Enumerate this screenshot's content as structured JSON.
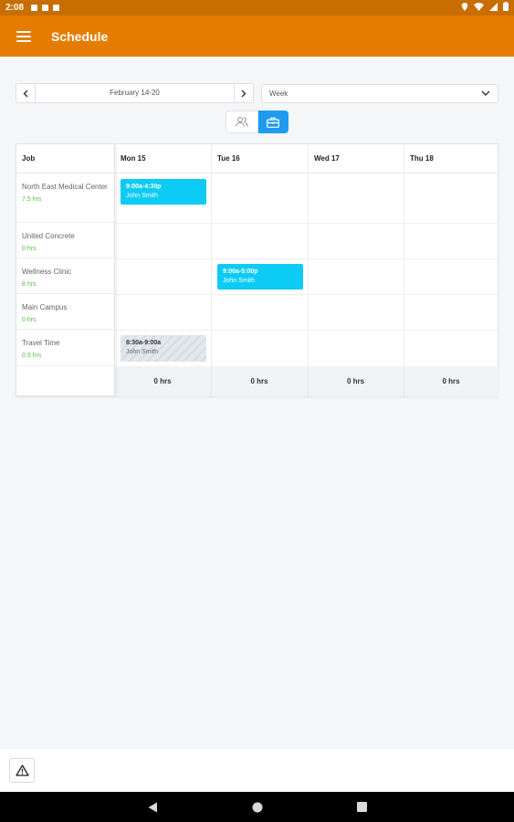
{
  "status_bar": {
    "time": "2:08"
  },
  "app_bar": {
    "title": "Schedule",
    "menu_icon": "hamburger-menu-icon"
  },
  "date_nav": {
    "range": "February 14-20",
    "prev_icon": "chevron-left-icon",
    "next_icon": "chevron-right-icon"
  },
  "view_select": {
    "value": "Week",
    "icon": "chevron-down-icon"
  },
  "toggle": {
    "people_icon": "people-icon",
    "jobs_icon": "briefcase-icon",
    "active": "jobs",
    "active_color": "#1e9bf0"
  },
  "schedule": {
    "job_header": "Job",
    "days": [
      {
        "label": "Mon 15",
        "total": "0 hrs"
      },
      {
        "label": "Tue 16",
        "total": "0 hrs"
      },
      {
        "label": "Wed 17",
        "total": "0 hrs"
      },
      {
        "label": "Thu 18",
        "total": "0 hrs"
      }
    ],
    "jobs": [
      {
        "name": "North East Medical Center",
        "hours": "7.5 hrs"
      },
      {
        "name": "United Concrete",
        "hours": "0 hrs"
      },
      {
        "name": "Wellness Clinic",
        "hours": "8 hrs"
      },
      {
        "name": "Main Campus",
        "hours": "0 hrs"
      },
      {
        "name": "Travel Time",
        "hours": "0.5 hrs"
      }
    ],
    "shifts": [
      {
        "time": "9:00a-4:30p",
        "name": "John Smith",
        "day": "Mon 15",
        "job": "North East Medical Center",
        "style": "published"
      },
      {
        "time": "9:00a-5:00p",
        "name": "John Smith",
        "day": "Tue 16",
        "job": "Wellness Clinic",
        "style": "published"
      },
      {
        "time": "8:30a-9:00a",
        "name": "John Smith",
        "day": "Mon 15",
        "job": "Travel Time",
        "style": "unpublished"
      }
    ]
  },
  "colors": {
    "app_bar": "#e57c00",
    "status_bar": "#c86d00",
    "shift": "#0ccbf4",
    "hours": "#5cc24a"
  },
  "bottom": {
    "warning_icon": "warning-icon"
  },
  "system_nav": {
    "back_icon": "back-icon",
    "home_icon": "home-icon",
    "recents_icon": "recents-icon"
  }
}
